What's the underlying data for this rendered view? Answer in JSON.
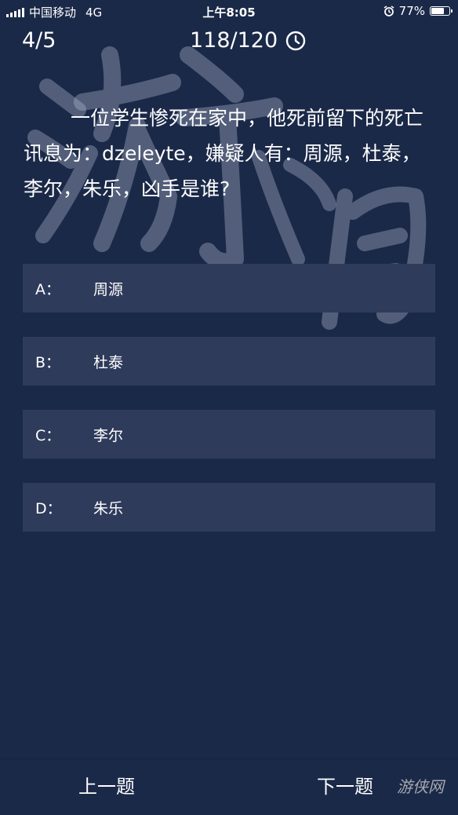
{
  "status_bar": {
    "carrier": "中国移动",
    "network": "4G",
    "time": "上午8:05",
    "battery_percent": "77%",
    "battery_level": 0.77
  },
  "header": {
    "progress": "4/5",
    "timer": "118/120",
    "timer_icon": "clock-icon"
  },
  "question": {
    "text": "一位学生惨死在家中，他死前留下的死亡讯息为：dzeleyte，嫌疑人有：周源，杜泰，李尔，朱乐，凶手是谁?"
  },
  "options": [
    {
      "letter": "A：",
      "text": "周源"
    },
    {
      "letter": "B：",
      "text": "杜泰"
    },
    {
      "letter": "C：",
      "text": "李尔"
    },
    {
      "letter": "D：",
      "text": "朱乐"
    }
  ],
  "nav": {
    "prev_label": "上一题",
    "next_label": "下一题"
  },
  "watermark": {
    "text": "游侠网"
  },
  "colors": {
    "background": "#1b2948",
    "option_bg": "#2f3b5b",
    "text": "#ffffff"
  }
}
